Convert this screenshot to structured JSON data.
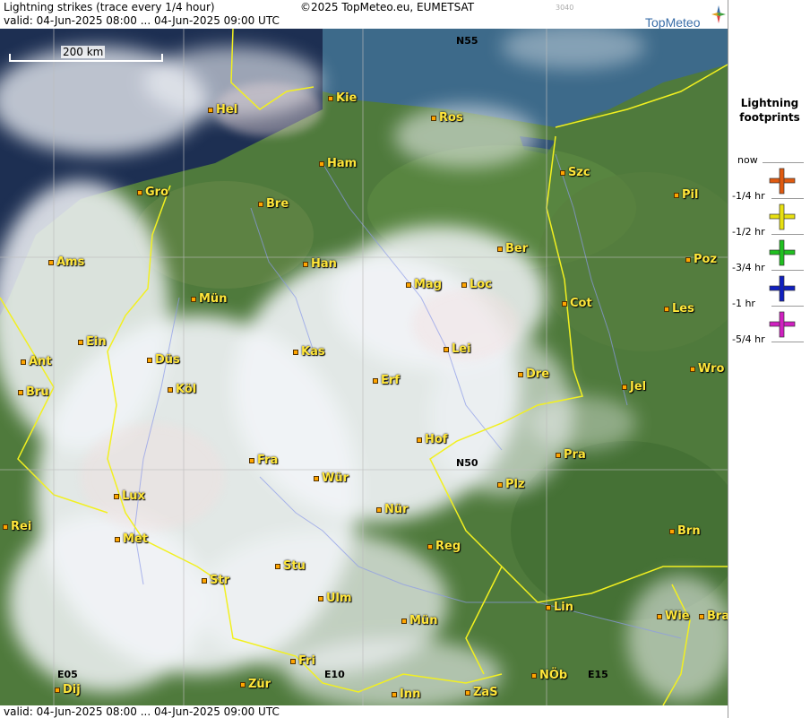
{
  "header": {
    "title": "Lightning strikes (trace every 1/4 hour)",
    "valid": "valid:  04-Jun-2025 08:00 ... 04-Jun-2025 09:00 UTC",
    "copyright": "©2025 TopMeteo.eu, EUMETSAT",
    "code": "3040",
    "logo_text": "TopMeteo"
  },
  "footer": {
    "valid": "valid:  04-Jun-2025 08:00 ... 04-Jun-2025 09:00 UTC"
  },
  "scale": {
    "label": "200 km"
  },
  "legend": {
    "title_line1": "Lightning",
    "title_line2": "footprints",
    "items": [
      {
        "label": "now",
        "color": "#e05a10"
      },
      {
        "label": "-1/4 hr",
        "color": "#e8e010"
      },
      {
        "label": "-1/2 hr",
        "color": "#20c020"
      },
      {
        "label": "-3/4 hr",
        "color": "#1020c0"
      },
      {
        "label": "-1 hr",
        "color": "#d020c0"
      },
      {
        "label": "-5/4 hr",
        "color": ""
      }
    ]
  },
  "grid_labels": [
    "N55",
    "N50",
    "E05",
    "E10",
    "E15"
  ],
  "cities": [
    {
      "name": "Kie"
    },
    {
      "name": "Hel"
    },
    {
      "name": "Ros"
    },
    {
      "name": "Ham"
    },
    {
      "name": "Szc"
    },
    {
      "name": "Gro"
    },
    {
      "name": "Bre"
    },
    {
      "name": "Pil"
    },
    {
      "name": "Ber"
    },
    {
      "name": "Ams"
    },
    {
      "name": "Han"
    },
    {
      "name": "Poz"
    },
    {
      "name": "Mag"
    },
    {
      "name": "Loc"
    },
    {
      "name": "Mün"
    },
    {
      "name": "Cot"
    },
    {
      "name": "Les"
    },
    {
      "name": "Ein"
    },
    {
      "name": "Kas"
    },
    {
      "name": "Lei"
    },
    {
      "name": "Ant"
    },
    {
      "name": "Düs"
    },
    {
      "name": "Wro"
    },
    {
      "name": "Dre"
    },
    {
      "name": "Bru"
    },
    {
      "name": "Köl"
    },
    {
      "name": "Erf"
    },
    {
      "name": "Jel"
    },
    {
      "name": "Hof"
    },
    {
      "name": "Fra"
    },
    {
      "name": "Pra"
    },
    {
      "name": "Wür"
    },
    {
      "name": "Plz"
    },
    {
      "name": "Lux"
    },
    {
      "name": "Rei"
    },
    {
      "name": "Nür"
    },
    {
      "name": "Met"
    },
    {
      "name": "Reg"
    },
    {
      "name": "Brn"
    },
    {
      "name": "Stu"
    },
    {
      "name": "Str"
    },
    {
      "name": "Ulm"
    },
    {
      "name": "Lin"
    },
    {
      "name": "Mün"
    },
    {
      "name": "Wie"
    },
    {
      "name": "Bra"
    },
    {
      "name": "Fri"
    },
    {
      "name": "NÖb"
    },
    {
      "name": "Dij"
    },
    {
      "name": "Zür"
    },
    {
      "name": "Inn"
    },
    {
      "name": "ZaS"
    }
  ]
}
